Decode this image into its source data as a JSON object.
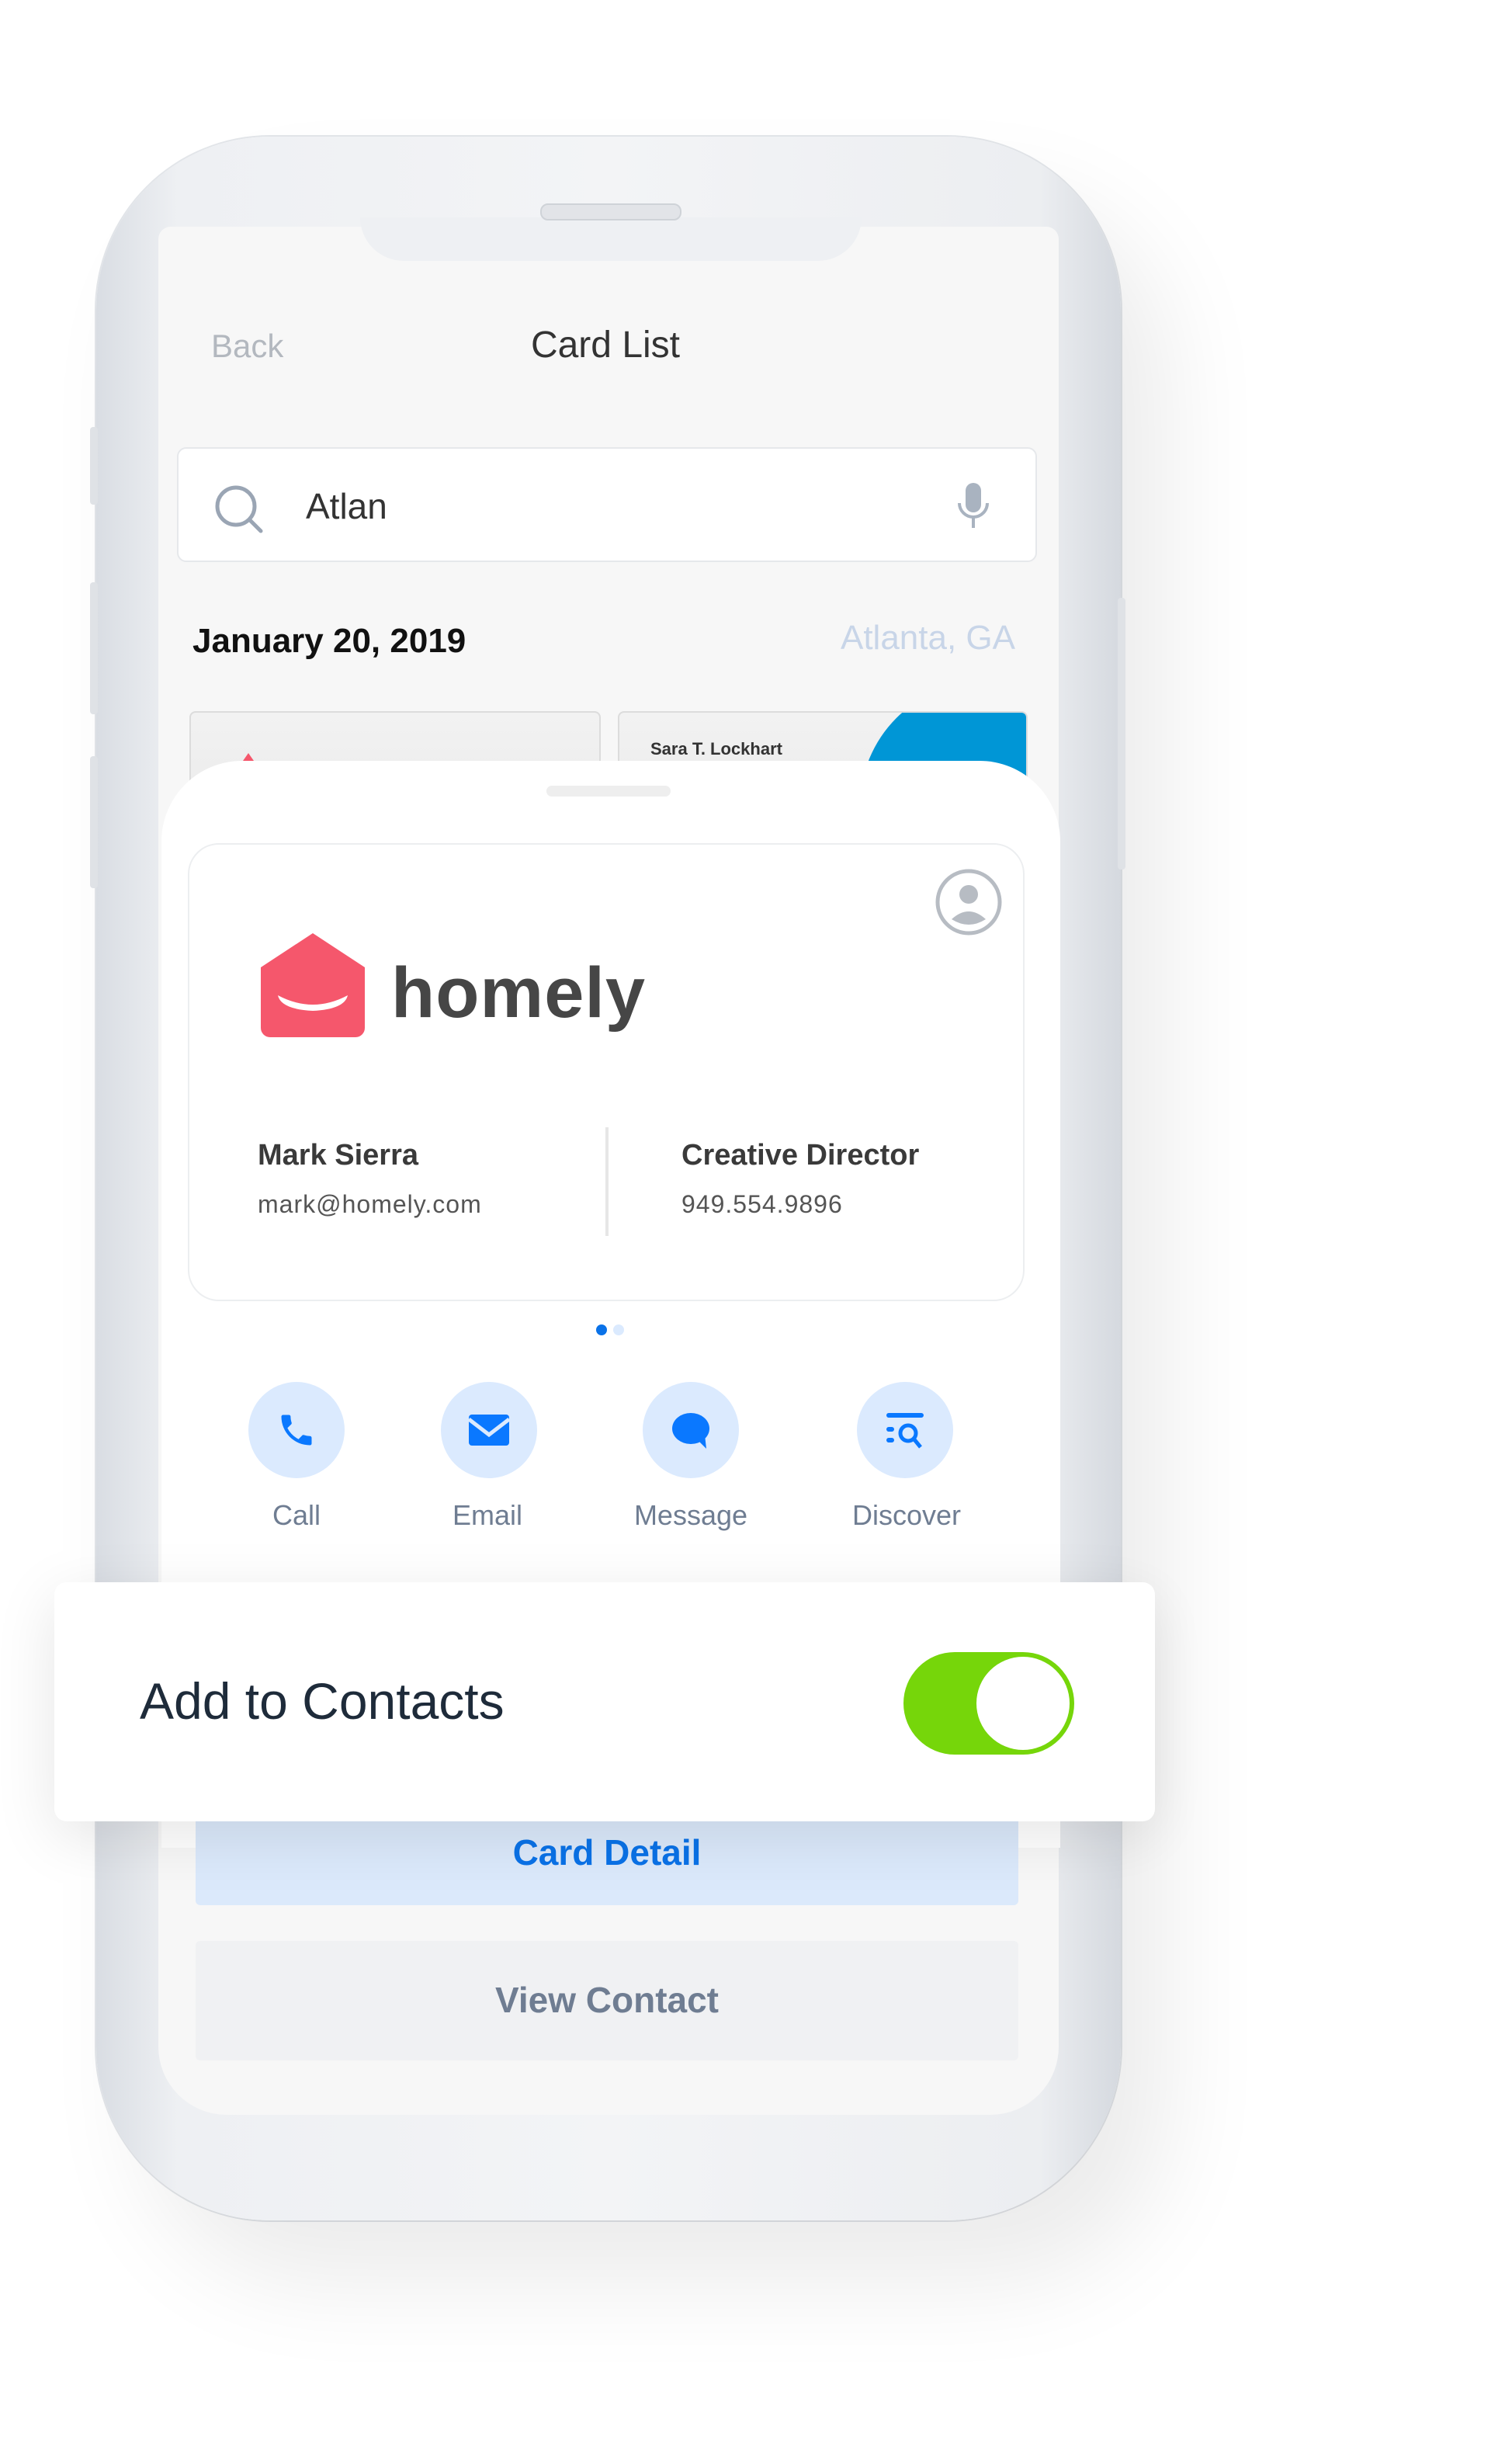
{
  "header": {
    "back_label": "Back",
    "title": "Card List"
  },
  "search": {
    "value": "Atlan",
    "search_icon": "search-icon",
    "mic_icon": "microphone-icon"
  },
  "group": {
    "date": "January 20, 2019",
    "location": "Atlanta, GA"
  },
  "background_cards": [
    {
      "name": ""
    },
    {
      "name": "Sara T. Lockhart"
    }
  ],
  "card": {
    "company": "homely",
    "name": "Mark Sierra",
    "email": "mark@homely.com",
    "job_title": "Creative Director",
    "phone": "949.554.9896",
    "brand_color": "#f5576c"
  },
  "pager": {
    "current": 1,
    "total": 2
  },
  "actions": [
    {
      "label": "Call",
      "icon": "phone-icon"
    },
    {
      "label": "Email",
      "icon": "envelope-icon"
    },
    {
      "label": "Message",
      "icon": "chat-bubble-icon"
    },
    {
      "label": "Discover",
      "icon": "discover-search-icon"
    }
  ],
  "toast": {
    "label": "Add to Contacts",
    "toggle_on": true,
    "toggle_color": "#76d60a"
  },
  "buttons": {
    "card_detail": "Card Detail",
    "view_contact": "View Contact"
  },
  "colors": {
    "accent": "#0a72e8",
    "action_bg": "#dbeafe"
  }
}
